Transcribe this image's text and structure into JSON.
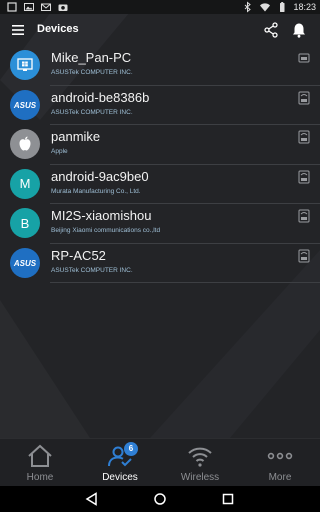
{
  "status_bar": {
    "time": "18:23"
  },
  "app_bar": {
    "title": "Devices"
  },
  "devices": [
    {
      "name": "Mike_Pan-PC",
      "vendor": "ASUSTek COMPUTER INC.",
      "icon": "windows-icon",
      "avatar_color": "#2b8fd8",
      "letter": ""
    },
    {
      "name": "android-be8386b",
      "vendor": "ASUSTek COMPUTER INC.",
      "icon": "asus-logo-icon",
      "avatar_color": "#1f6fc2",
      "letter": ""
    },
    {
      "name": "panmike",
      "vendor": "Apple",
      "icon": "apple-icon",
      "avatar_color": "#8e9094",
      "letter": ""
    },
    {
      "name": "android-9ac9be0",
      "vendor": "Murata Manufacturing Co., Ltd.",
      "icon": "letter-avatar",
      "avatar_color": "#17a2a6",
      "letter": "M"
    },
    {
      "name": "MI2S-xiaomishou",
      "vendor": "Beijing Xiaomi communications co.,ltd",
      "icon": "letter-avatar",
      "avatar_color": "#17a2a6",
      "letter": "B"
    },
    {
      "name": "RP-AC52",
      "vendor": "ASUSTek COMPUTER INC.",
      "icon": "asus-logo-icon",
      "avatar_color": "#1f6fc2",
      "letter": ""
    }
  ],
  "bottom_nav": {
    "home": "Home",
    "devices": "Devices",
    "devices_badge": "6",
    "wireless": "Wireless",
    "more": "More"
  },
  "colors": {
    "accent": "#2f7fd4",
    "background": "#232427",
    "vendor_text": "#9fbfd6"
  }
}
